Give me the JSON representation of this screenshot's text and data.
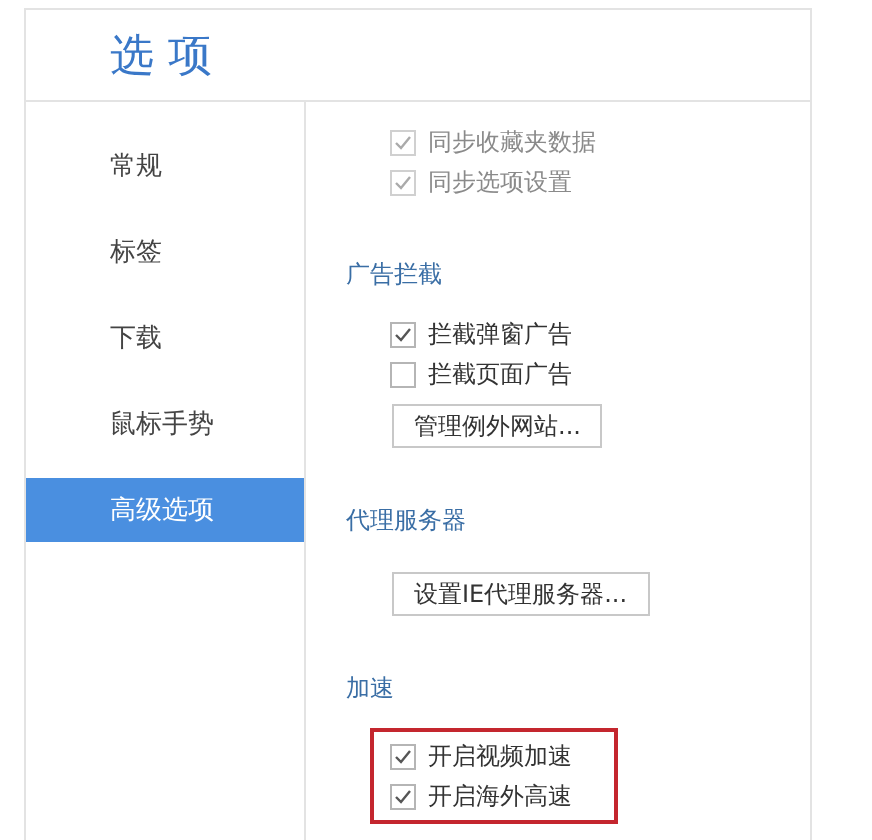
{
  "window": {
    "title": "选 项"
  },
  "sidebar": {
    "items": [
      {
        "label": "常规",
        "selected": false
      },
      {
        "label": "标签",
        "selected": false
      },
      {
        "label": "下载",
        "selected": false
      },
      {
        "label": "鼠标手势",
        "selected": false
      },
      {
        "label": "高级选项",
        "selected": true
      }
    ]
  },
  "sections": [
    {
      "checks": [
        {
          "label": "同步收藏夹数据",
          "checked": true,
          "disabled": true
        },
        {
          "label": "同步选项设置",
          "checked": true,
          "disabled": true
        }
      ],
      "highlighted": false
    },
    {
      "heading": "广告拦截",
      "checks": [
        {
          "label": "拦截弹窗广告",
          "checked": true,
          "disabled": false
        },
        {
          "label": "拦截页面广告",
          "checked": false,
          "disabled": false
        }
      ],
      "button": "管理例外网站...",
      "highlighted": false
    },
    {
      "heading": "代理服务器",
      "button": "设置IE代理服务器...",
      "highlighted": false
    },
    {
      "heading": "加速",
      "checks": [
        {
          "label": "开启视频加速",
          "checked": true,
          "disabled": false
        },
        {
          "label": "开启海外高速",
          "checked": true,
          "disabled": false
        }
      ],
      "highlighted": true
    }
  ]
}
